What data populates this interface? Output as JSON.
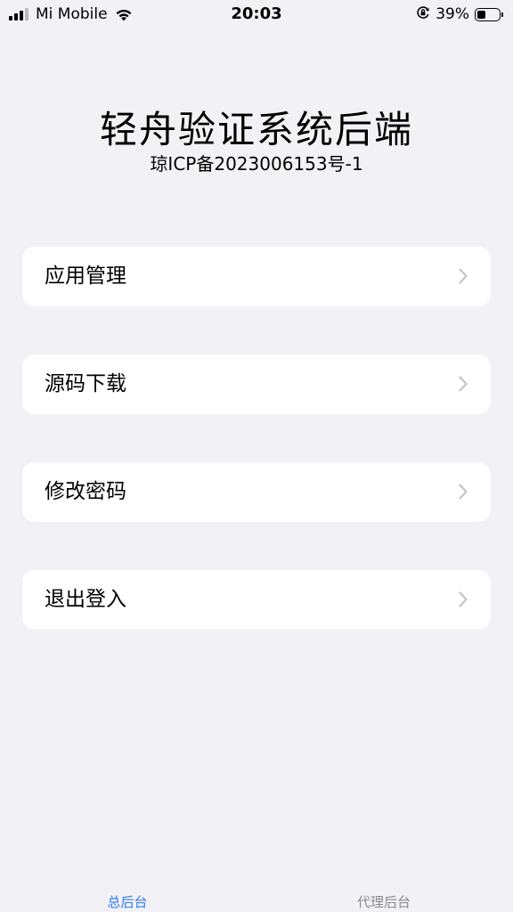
{
  "status_bar": {
    "carrier": "Mi Mobile",
    "time": "20:03",
    "battery_percent": "39%",
    "battery_level": 0.39,
    "icons": [
      "signal-icon",
      "wifi-icon",
      "orientation-lock-icon",
      "battery-icon"
    ]
  },
  "header": {
    "title": "轻舟验证系统后端",
    "subtitle": "琼ICP备2023006153号-1"
  },
  "menu": {
    "items": [
      {
        "label": "应用管理",
        "icon": "chevron-right-icon"
      },
      {
        "label": "源码下载",
        "icon": "chevron-right-icon"
      },
      {
        "label": "修改密码",
        "icon": "chevron-right-icon"
      },
      {
        "label": "退出登入",
        "icon": "chevron-right-icon"
      }
    ]
  },
  "tabbar": {
    "tabs": [
      {
        "label": "总后台",
        "active": true
      },
      {
        "label": "代理后台",
        "active": false
      }
    ],
    "active_color": "#2f7bf5",
    "inactive_color": "#8a8a8e"
  },
  "colors": {
    "background": "#f2f1f6",
    "card": "#ffffff",
    "chevron": "#c4c4c8"
  }
}
